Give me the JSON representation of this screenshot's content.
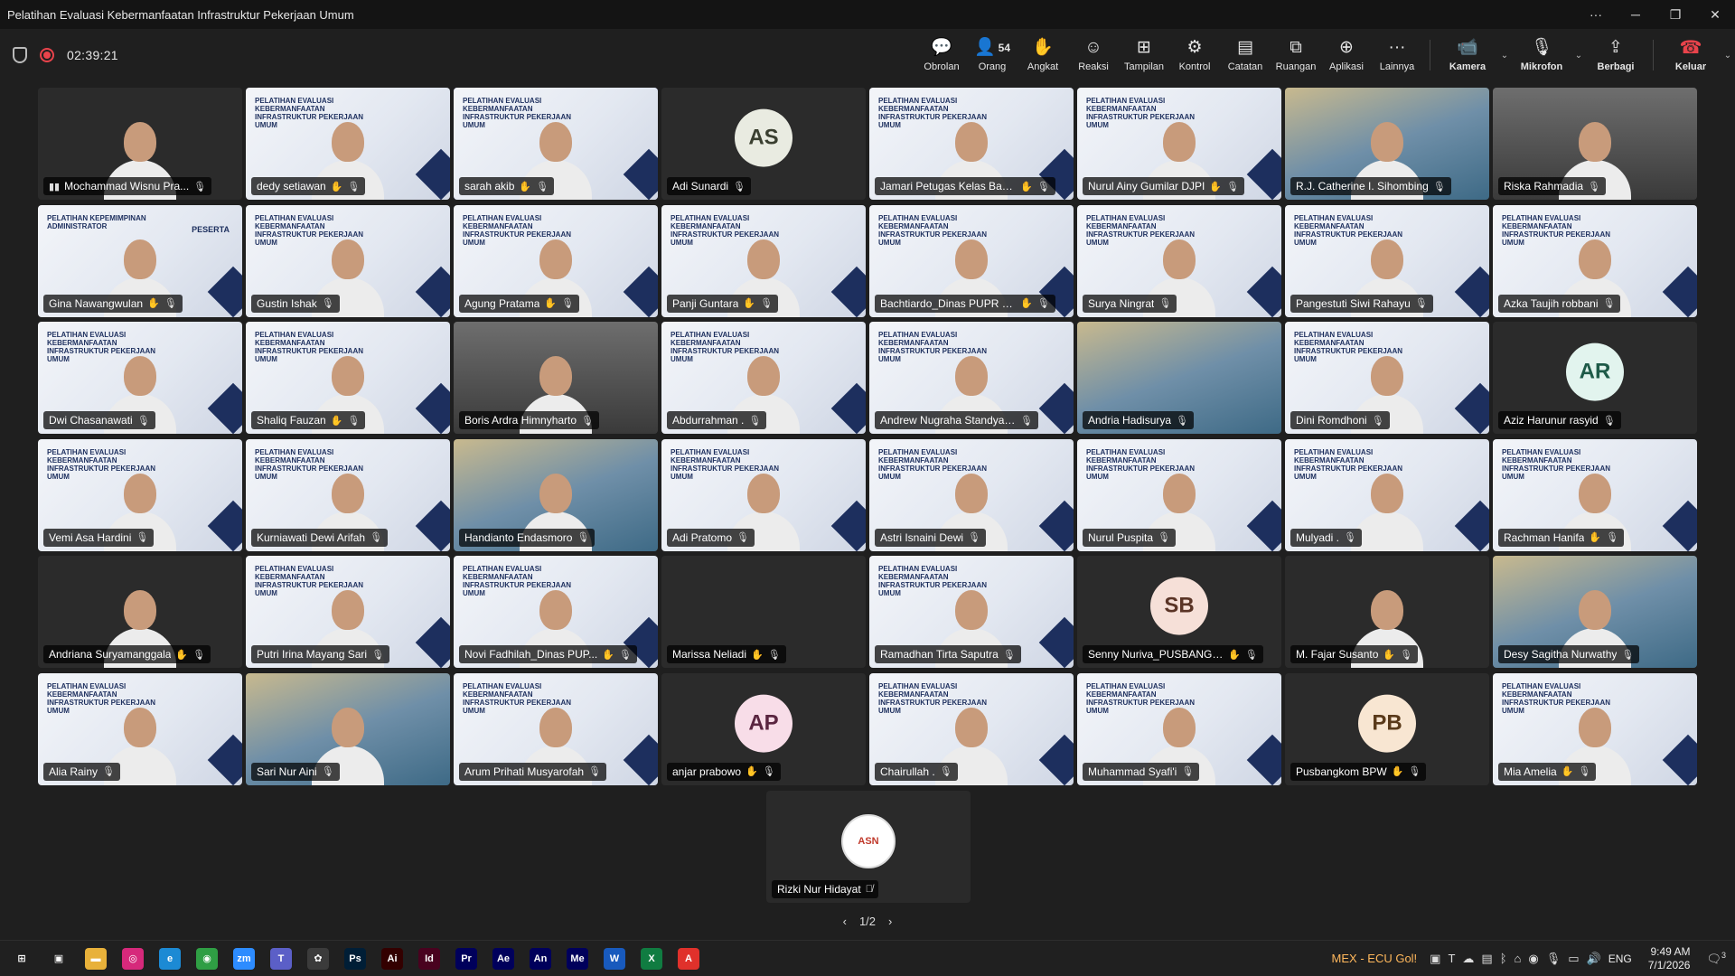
{
  "window": {
    "title": "Pelatihan Evaluasi Kebermanfaatan Infrastruktur Pekerjaan Umum",
    "controls": [
      "···",
      "─",
      "❐",
      "✕"
    ]
  },
  "meeting": {
    "timer": "02:39:21",
    "people_count": "54",
    "toolbar": [
      {
        "id": "chat",
        "label": "Obrolan",
        "icon": "💬"
      },
      {
        "id": "people",
        "label": "Orang",
        "icon": "👤"
      },
      {
        "id": "raise",
        "label": "Angkat",
        "icon": "✋"
      },
      {
        "id": "react",
        "label": "Reaksi",
        "icon": "☺"
      },
      {
        "id": "view",
        "label": "Tampilan",
        "icon": "⊞"
      },
      {
        "id": "control",
        "label": "Kontrol",
        "icon": "⚙"
      },
      {
        "id": "notes",
        "label": "Catatan",
        "icon": "▤"
      },
      {
        "id": "rooms",
        "label": "Ruangan",
        "icon": "⧉"
      },
      {
        "id": "apps",
        "label": "Aplikasi",
        "icon": "⊕"
      },
      {
        "id": "more",
        "label": "Lainnya",
        "icon": "···"
      }
    ],
    "camera_label": "Kamera",
    "mic_label": "Mikrofon",
    "share_label": "Berbagi",
    "leave_label": "Keluar",
    "slide_text": "PELATIHAN EVALUASI KEBERMANFAATAN INFRASTRUKTUR PEKERJAAN UMUM",
    "slide_text_admin": "PELATIHAN KEPEMIMPINAN ADMINISTRATOR",
    "peserta_label": "PESERTA",
    "page_indicator": "1/2"
  },
  "participants": [
    {
      "name": "Mochammad Wisnu Pra...",
      "bg": "dark",
      "video": true,
      "speaking": true
    },
    {
      "name": "dedy setiawan",
      "bg": "slide",
      "video": true,
      "hand": true
    },
    {
      "name": "sarah akib",
      "bg": "slide",
      "video": true,
      "hand": true,
      "active": true
    },
    {
      "name": "Adi Sunardi",
      "bg": "dark",
      "initials": "AS",
      "avatar_color": "#e9ebe1",
      "avatar_text": "#3a3f30"
    },
    {
      "name": "Jamari Petugas Kelas Bap...",
      "bg": "slide",
      "video": true,
      "hand": true
    },
    {
      "name": "Nurul Ainy Gumilar DJPI",
      "bg": "slide",
      "video": true,
      "hand": true
    },
    {
      "name": "R.J. Catherine I. Sihombing",
      "bg": "batik",
      "video": true
    },
    {
      "name": "Riska Rahmadia",
      "bg": "room",
      "video": true
    },
    {
      "name": "Gina Nawangwulan",
      "bg": "admin",
      "video": true,
      "hand": true
    },
    {
      "name": "Gustin Ishak",
      "bg": "slide",
      "video": true
    },
    {
      "name": "Agung Pratama",
      "bg": "slide",
      "video": true,
      "hand": true
    },
    {
      "name": "Panji Guntara",
      "bg": "slide",
      "video": true,
      "hand": true
    },
    {
      "name": "Bachtiardo_Dinas PUPR N...",
      "bg": "slide",
      "video": true,
      "hand": true
    },
    {
      "name": "Surya Ningrat",
      "bg": "slide",
      "video": true
    },
    {
      "name": "Pangestuti Siwi Rahayu",
      "bg": "slide",
      "video": true
    },
    {
      "name": "Azka Taujih robbani",
      "bg": "slide",
      "video": true
    },
    {
      "name": "Dwi Chasanawati",
      "bg": "slide",
      "video": true
    },
    {
      "name": "Shaliq Fauzan",
      "bg": "slide",
      "video": true,
      "hand": true
    },
    {
      "name": "Boris Ardra Himnyharto",
      "bg": "room",
      "video": true
    },
    {
      "name": "Abdurrahman .",
      "bg": "slide",
      "video": true
    },
    {
      "name": "Andrew Nugraha Standyarto",
      "bg": "slide",
      "video": true
    },
    {
      "name": "Andria Hadisurya",
      "bg": "batik",
      "video": false
    },
    {
      "name": "Dini Romdhoni",
      "bg": "slide",
      "video": true
    },
    {
      "name": "Aziz Harunur rasyid",
      "bg": "dark",
      "initials": "AR",
      "avatar_color": "#e2f4ee",
      "avatar_text": "#1e5a48"
    },
    {
      "name": "Vemi Asa Hardini",
      "bg": "slide",
      "video": true
    },
    {
      "name": "Kurniawati Dewi Arifah",
      "bg": "slide",
      "video": true
    },
    {
      "name": "Handianto Endasmoro",
      "bg": "batik",
      "video": true
    },
    {
      "name": "Adi Pratomo",
      "bg": "slide",
      "video": true
    },
    {
      "name": "Astri Isnaini Dewi",
      "bg": "slide",
      "video": true
    },
    {
      "name": "Nurul Puspita",
      "bg": "slide",
      "video": true
    },
    {
      "name": "Mulyadi .",
      "bg": "slide",
      "video": true
    },
    {
      "name": "Rachman Hanifa",
      "bg": "slide",
      "video": true,
      "hand": true
    },
    {
      "name": "Andriana Suryamanggala",
      "bg": "dark",
      "video": true,
      "hand": true
    },
    {
      "name": "Putri Irina Mayang Sari",
      "bg": "slide",
      "video": true
    },
    {
      "name": "Novi Fadhilah_Dinas PUP...",
      "bg": "slide",
      "video": true,
      "hand": true
    },
    {
      "name": "Marissa Neliadi",
      "bg": "dark",
      "video": false,
      "hand": true
    },
    {
      "name": "Ramadhan Tirta Saputra",
      "bg": "slide",
      "video": true
    },
    {
      "name": "Senny Nuriva_PUSBANGK...",
      "bg": "dark",
      "initials": "SB",
      "avatar_color": "#f6e0d8",
      "avatar_text": "#5a3426",
      "hand": true
    },
    {
      "name": "M. Fajar Susanto",
      "bg": "dark",
      "video": true,
      "hand": true
    },
    {
      "name": "Desy Sagitha Nurwathy",
      "bg": "batik",
      "video": true
    },
    {
      "name": "Alia Rainy",
      "bg": "slide",
      "video": true
    },
    {
      "name": "Sari Nur Aini",
      "bg": "batik",
      "video": true
    },
    {
      "name": "Arum Prihati Musyarofah",
      "bg": "slide",
      "video": true
    },
    {
      "name": "anjar prabowo",
      "bg": "dark",
      "initials": "AP",
      "avatar_color": "#f8dde8",
      "avatar_text": "#5a2540",
      "hand": true
    },
    {
      "name": "Chairullah .",
      "bg": "slide",
      "video": true
    },
    {
      "name": "Muhammad Syafi'i",
      "bg": "slide",
      "video": true
    },
    {
      "name": "Pusbangkom BPW",
      "bg": "dark",
      "initials": "PB",
      "avatar_color": "#f8e6d2",
      "avatar_text": "#5a3a1a",
      "hand": true
    },
    {
      "name": "Mia Amelia",
      "bg": "slide",
      "video": true,
      "hand": true
    }
  ],
  "extra_participant": {
    "name": "Rizki Nur Hidayat",
    "avatar_badge": "ASN"
  },
  "taskbar": {
    "apps": [
      {
        "id": "start",
        "glyph": "⊞",
        "color": "#202020"
      },
      {
        "id": "taskview",
        "glyph": "▣",
        "color": "#202020"
      },
      {
        "id": "explorer",
        "glyph": "▬",
        "color": "#e8b13a"
      },
      {
        "id": "instagram",
        "glyph": "◎",
        "color": "#d6297b"
      },
      {
        "id": "edge",
        "glyph": "e",
        "color": "#1c8ad4"
      },
      {
        "id": "chrome",
        "glyph": "◉",
        "color": "#2f9e44"
      },
      {
        "id": "zoom",
        "glyph": "zm",
        "color": "#2d8cff"
      },
      {
        "id": "teams",
        "glyph": "T",
        "color": "#5b5fc7"
      },
      {
        "id": "paint",
        "glyph": "✿",
        "color": "#3b3b3b"
      },
      {
        "id": "photoshop",
        "glyph": "Ps",
        "color": "#001e36"
      },
      {
        "id": "illustrator",
        "glyph": "Ai",
        "color": "#330000"
      },
      {
        "id": "indesign",
        "glyph": "Id",
        "color": "#49021f"
      },
      {
        "id": "premiere",
        "glyph": "Pr",
        "color": "#00005b"
      },
      {
        "id": "aftereffects",
        "glyph": "Ae",
        "color": "#00005b"
      },
      {
        "id": "animate",
        "glyph": "An",
        "color": "#00005b"
      },
      {
        "id": "mediaencoder",
        "glyph": "Me",
        "color": "#00005b"
      },
      {
        "id": "word",
        "glyph": "W",
        "color": "#185abd"
      },
      {
        "id": "excel",
        "glyph": "X",
        "color": "#107c41"
      },
      {
        "id": "acrobat",
        "glyph": "A",
        "color": "#e0312b"
      }
    ],
    "news": "MEX - ECU Gol!",
    "lang": "ENG",
    "time": "9:49 AM",
    "date": "7/1/2026",
    "notif_count": "3"
  }
}
